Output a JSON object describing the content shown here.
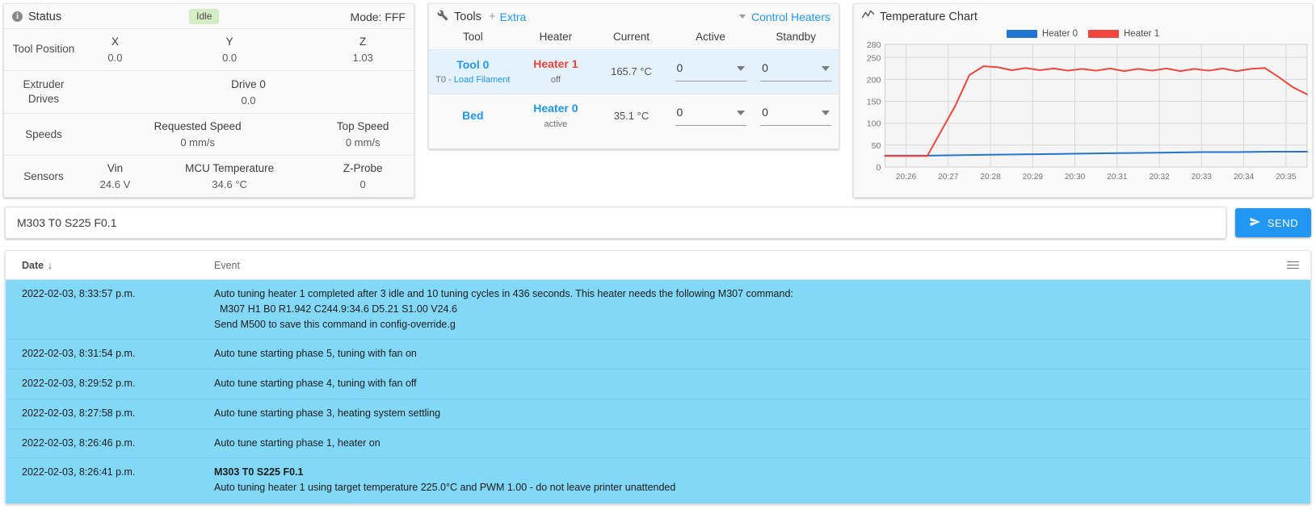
{
  "status_panel": {
    "title": "Status",
    "info_icon": "info-icon",
    "badge": "Idle",
    "mode": "Mode: FFF",
    "rows": [
      {
        "label": "Tool Position",
        "cells": [
          {
            "head": "X",
            "value": "0.0"
          },
          {
            "head": "Y",
            "value": "0.0"
          },
          {
            "head": "Z",
            "value": "1.03"
          }
        ]
      },
      {
        "label": "Extruder\nDrives",
        "cells": [
          {
            "head": "Drive 0",
            "value": "0.0"
          }
        ]
      },
      {
        "label": "Speeds",
        "cells": [
          {
            "head": "Requested Speed",
            "value": "0 mm/s"
          },
          {
            "head": "Top Speed",
            "value": "0 mm/s"
          }
        ]
      },
      {
        "label": "Sensors",
        "cells": [
          {
            "head": "Vin",
            "value": "24.6 V"
          },
          {
            "head": "MCU Temperature",
            "value": "34.6 °C"
          },
          {
            "head": "Z-Probe",
            "value": "0"
          }
        ]
      }
    ]
  },
  "tools_panel": {
    "title": "Tools",
    "wrench_icon": "wrench-icon",
    "plus": "+",
    "extra_link": "Extra",
    "control_heaters_link": "Control Heaters",
    "columns": [
      "Tool",
      "Heater",
      "Current",
      "Active",
      "Standby"
    ],
    "rows": [
      {
        "tool": "Tool 0",
        "tool_sub_prefix": "T0 - ",
        "tool_sub_link": "Load Filament",
        "heater": "Heater 1",
        "heater_color": "#f44336",
        "heater_state": "off",
        "current": "165.7 °C",
        "active": "0",
        "standby": "0",
        "selected": true
      },
      {
        "tool": "Bed",
        "tool_sub_prefix": "",
        "tool_sub_link": "",
        "heater": "Heater 0",
        "heater_color": "#2196f3",
        "heater_state": "active",
        "current": "35.1 °C",
        "active": "0",
        "standby": "0",
        "selected": false
      }
    ]
  },
  "chart_panel": {
    "title": "Temperature Chart",
    "chart_icon": "line-chart-icon"
  },
  "chart_data": {
    "type": "line",
    "title": "Temperature Chart",
    "xlabel": "",
    "ylabel": "",
    "ylim": [
      0,
      280
    ],
    "yticks": [
      0,
      50,
      100,
      150,
      200,
      250,
      280
    ],
    "xticks": [
      "20:26",
      "20:27",
      "20:28",
      "20:29",
      "20:30",
      "20:31",
      "20:32",
      "20:33",
      "20:34",
      "20:35"
    ],
    "grid": true,
    "legend_position": "top-center",
    "series": [
      {
        "name": "Heater 0",
        "color": "#2176d2",
        "x": [
          20.4,
          20.44,
          20.46,
          20.5,
          20.55,
          20.6,
          20.65,
          20.7,
          20.75,
          20.8,
          20.85,
          20.9,
          20.95,
          21.0
        ],
        "values": [
          26,
          26,
          26,
          27,
          28,
          29,
          30,
          31,
          32,
          33,
          34,
          34,
          35,
          35
        ]
      },
      {
        "name": "Heater 1",
        "color": "#f2453d",
        "x": [
          20.4,
          20.44,
          20.46,
          20.5,
          20.52,
          20.54,
          20.56,
          20.58,
          20.6,
          20.62,
          20.64,
          20.66,
          20.68,
          20.7,
          20.72,
          20.74,
          20.76,
          20.78,
          20.8,
          20.82,
          20.84,
          20.86,
          20.88,
          20.9,
          20.92,
          20.94,
          20.96,
          20.98,
          21.0
        ],
        "values": [
          25,
          25,
          25,
          140,
          210,
          230,
          228,
          221,
          226,
          221,
          225,
          220,
          224,
          220,
          225,
          219,
          224,
          220,
          225,
          219,
          224,
          220,
          225,
          219,
          224,
          226,
          205,
          182,
          166
        ]
      }
    ]
  },
  "console": {
    "command_value": "M303 T0 S225 F0.1",
    "send_label": "SEND",
    "send_icon": "send-icon"
  },
  "log_table": {
    "columns": {
      "date": "Date",
      "sort_arrow": "↓",
      "event": "Event",
      "menu_icon": "hamburger-menu-icon"
    },
    "rows": [
      {
        "date": "2022-02-03, 8:33:57 p.m.",
        "lines": [
          {
            "text": "Auto tuning heater 1 completed after 3 idle and 10 tuning cycles in 436 seconds. This heater needs the following M307 command:",
            "bold": false
          },
          {
            "text": "  M307 H1 B0 R1.942 C244.9:34.6 D5.21 S1.00 V24.6",
            "bold": false
          },
          {
            "text": "Send M500 to save this command in config-override.g",
            "bold": false
          }
        ]
      },
      {
        "date": "2022-02-03, 8:31:54 p.m.",
        "lines": [
          {
            "text": "Auto tune starting phase 5, tuning with fan on",
            "bold": false
          }
        ]
      },
      {
        "date": "2022-02-03, 8:29:52 p.m.",
        "lines": [
          {
            "text": "Auto tune starting phase 4, tuning with fan off",
            "bold": false
          }
        ]
      },
      {
        "date": "2022-02-03, 8:27:58 p.m.",
        "lines": [
          {
            "text": "Auto tune starting phase 3, heating system settling",
            "bold": false
          }
        ]
      },
      {
        "date": "2022-02-03, 8:26:46 p.m.",
        "lines": [
          {
            "text": "Auto tune starting phase 1, heater on",
            "bold": false
          }
        ]
      },
      {
        "date": "2022-02-03, 8:26:41 p.m.",
        "lines": [
          {
            "text": "M303 T0 S225 F0.1",
            "bold": true
          },
          {
            "text": "Auto tuning heater 1 using target temperature 225.0°C and PWM 1.00 - do not leave printer unattended",
            "bold": false
          }
        ]
      }
    ]
  },
  "colors": {
    "accent": "#2196f3",
    "heater0": "#2176d2",
    "heater1": "#f2453d",
    "log_row_bg": "#82d8f7",
    "badge_bg": "#d4edc4"
  }
}
